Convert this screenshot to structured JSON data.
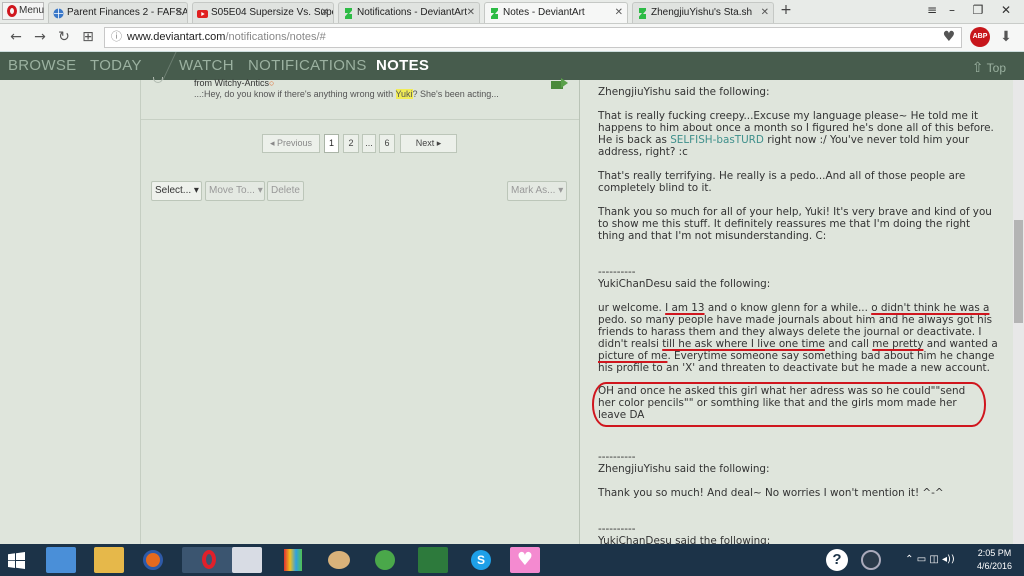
{
  "browser": {
    "menu_label": "Menu",
    "tabs": [
      {
        "title": "Parent Finances 2 - FAFSA"
      },
      {
        "title": "S05E04 Supersize Vs. Supe"
      },
      {
        "title": "Notifications - DeviantArt"
      },
      {
        "title": "Notes - DeviantArt"
      },
      {
        "title": "ZhengjiuYishu's Sta.sh"
      }
    ],
    "url_host": "www.deviantart.com",
    "url_path": "/notifications/notes/#",
    "adblock_label": "ABP"
  },
  "da_nav": {
    "items": [
      "BROWSE",
      "TODAY",
      "WATCH",
      "NOTIFICATIONS",
      "NOTES"
    ],
    "top_label": "Top"
  },
  "note_list": {
    "row": {
      "from": "from Witchy-Antics",
      "preview_before": "...:Hey, do you know if there's anything wrong with ",
      "preview_highlight": "Yuki",
      "preview_after": "? She's been acting..."
    },
    "pager": {
      "previous": "Previous",
      "pages": [
        "1",
        "2",
        "...",
        "6"
      ],
      "next": "Next"
    },
    "actions": {
      "select": "Select...",
      "move_to": "Move To...",
      "delete": "Delete",
      "mark_as": "Mark As..."
    }
  },
  "note_thread": {
    "separator": "----------",
    "h1": "ZhengjiuYishu said the following:",
    "p1a": "That is really fucking creepy...Excuse my language please~ He told me it happens to him about once a month so I figured he's done all of this before. He is back as ",
    "p1link": "SELFISH-basTURD",
    "p1b": " right now :/ You've never told him your address, right? :c",
    "p2": "That's really terrifying. He really is a pedo...And all of those people are completely blind to it.",
    "p3": "Thank you so much for all of your help, Yuki! It's very brave and kind of you to show me this stuff. It definitely reassures me that I'm doing the right thing and that I'm not misunderstanding. C:",
    "h2": "YukiChanDesu said the following:",
    "y1": "ur welcome. ",
    "y2": "I am 13",
    "y3": " and o know glenn for a while... ",
    "y4": "o didn't think he was a",
    "y5": " pedo. so many people have made journals about him and he always got his friends to harass them and they always delete the journal or deactivate. I didn't realsi ",
    "y6": "till he ask where I live one time",
    "y7": " and call ",
    "y8": "me pretty",
    "y9": " and wanted a ",
    "y10": "picture of me",
    "y11": ". Everytime someone say something bad about him he change his profile to an 'X' and threaten to deactivate but he made a new account.",
    "y12": "OH and once he asked this girl what her adress was so he could\"\"send her color pencils\"\" or somthing like that and the girls mom made her leave DA",
    "h3": "ZhengjiuYishu said the following:",
    "p4": "Thank you so much! And deal~ No worries I won't mention it! ^-^",
    "h4": "YukiChanDesu said the following:"
  },
  "taskbar": {
    "time": "2:05 PM",
    "date": "4/6/2016"
  },
  "colors": {
    "da_nav_bg": "#475c4d",
    "page_bg": "#dfe5dc",
    "taskbar_bg": "#1c3348",
    "annotation_red": "#d0161e"
  }
}
